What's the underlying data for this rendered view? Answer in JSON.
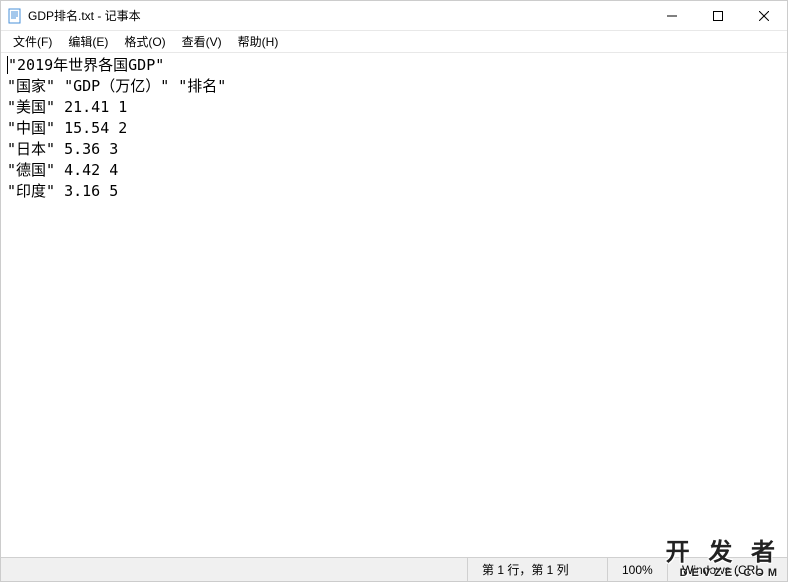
{
  "window": {
    "title": "GDP排名.txt - 记事本"
  },
  "menu": {
    "file": "文件(F)",
    "edit": "编辑(E)",
    "format": "格式(O)",
    "view": "查看(V)",
    "help": "帮助(H)"
  },
  "content": {
    "lines": [
      "\"2019年世界各国GDP\"",
      "\"国家\" \"GDP（万亿）\" \"排名\"",
      "\"美国\" 21.41 1",
      "\"中国\" 15.54 2",
      "\"日本\" 5.36 3",
      "\"德国\" 4.42 4",
      "\"印度\" 3.16 5"
    ]
  },
  "statusbar": {
    "position": "第 1 行，第 1 列",
    "zoom": "100%",
    "encoding": "Windows (CRL"
  },
  "watermark": {
    "main": "开 发 者",
    "sub": "DEVZE.COM"
  },
  "chart_data": {
    "type": "table",
    "title": "2019年世界各国GDP",
    "columns": [
      "国家",
      "GDP（万亿）",
      "排名"
    ],
    "rows": [
      {
        "country": "美国",
        "gdp": 21.41,
        "rank": 1
      },
      {
        "country": "中国",
        "gdp": 15.54,
        "rank": 2
      },
      {
        "country": "日本",
        "gdp": 5.36,
        "rank": 3
      },
      {
        "country": "德国",
        "gdp": 4.42,
        "rank": 4
      },
      {
        "country": "印度",
        "gdp": 3.16,
        "rank": 5
      }
    ]
  }
}
